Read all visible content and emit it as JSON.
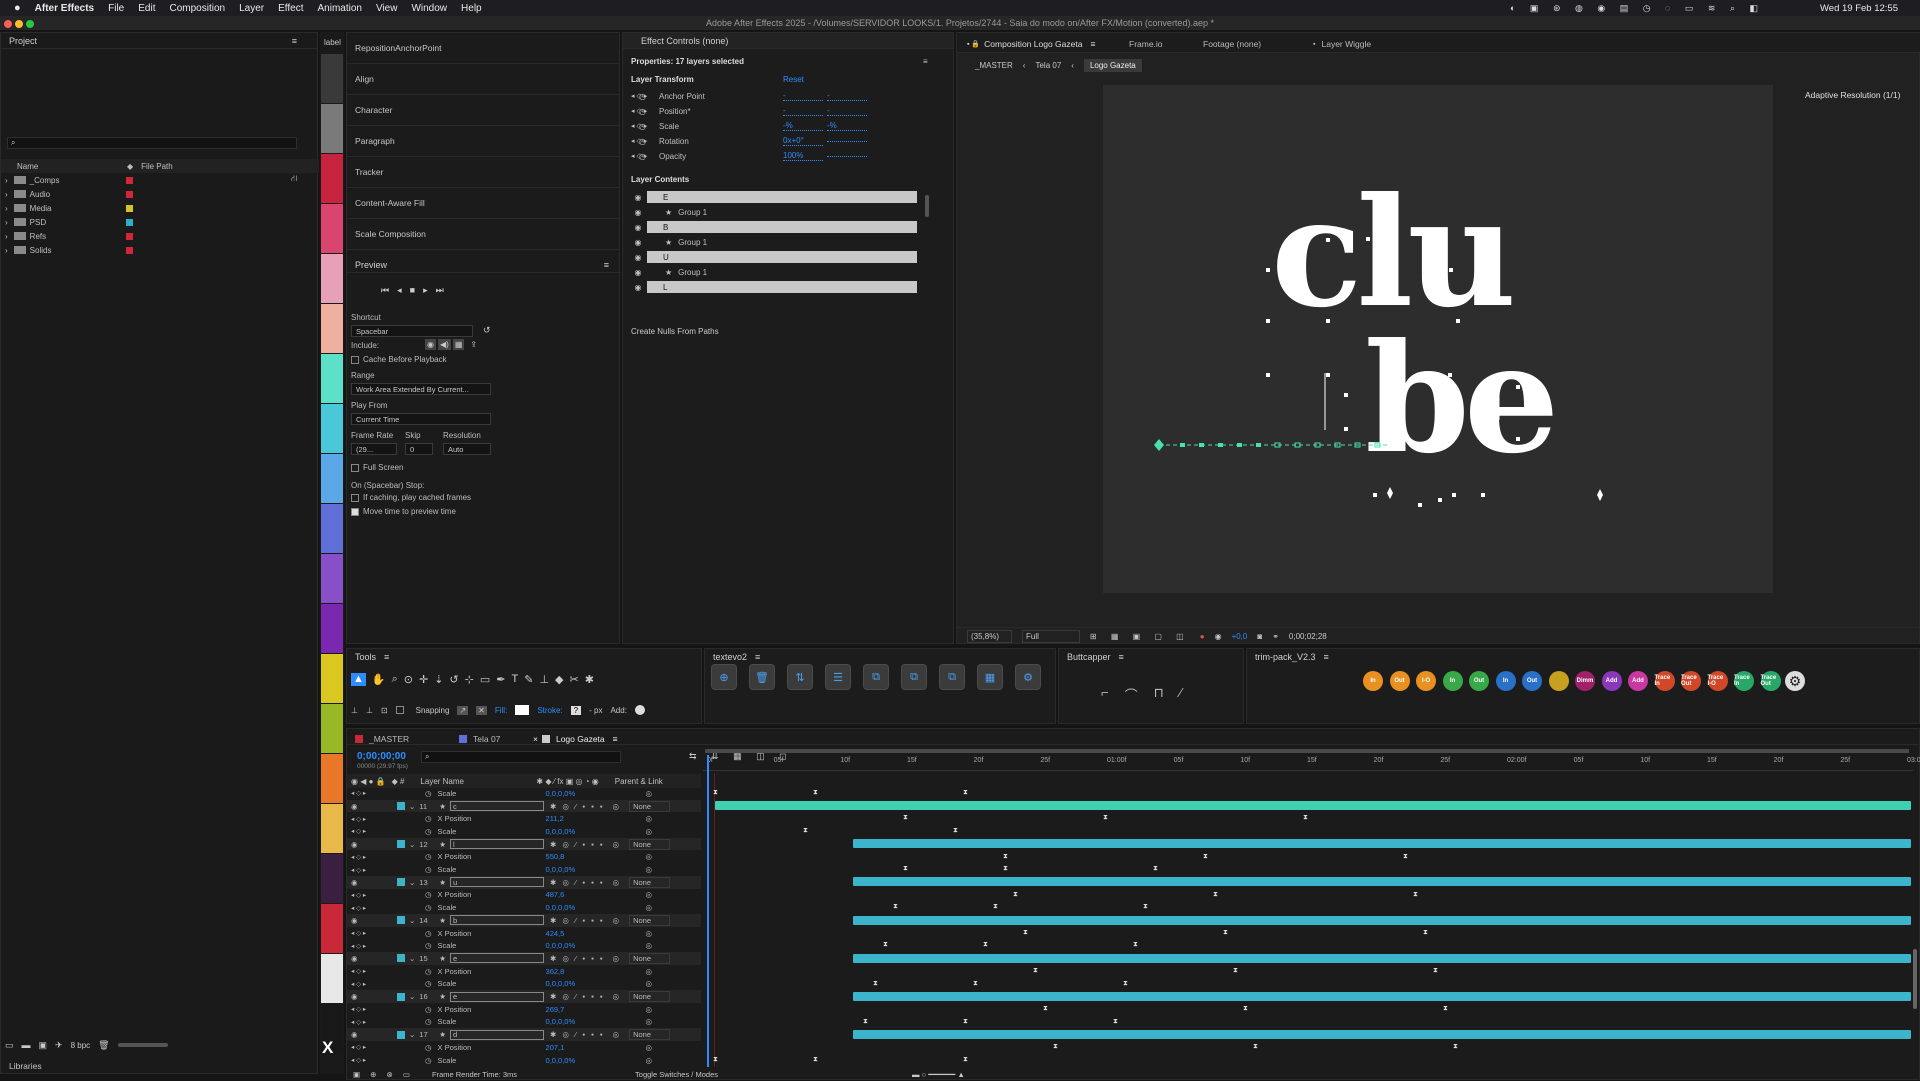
{
  "menubar": {
    "apple": "",
    "app": "After Effects",
    "items": [
      "File",
      "Edit",
      "Composition",
      "Layer",
      "Effect",
      "Animation",
      "View",
      "Window",
      "Help"
    ],
    "clock": "Wed 19 Feb 12:55"
  },
  "window_title": "Adobe After Effects 2025 - /Volumes/SERVIDOR LOOKS/1. Projetos/2744 - Saia do modo on/After FX/Motion (converted).aep *",
  "project": {
    "title": "Project",
    "col_name": "Name",
    "col_path": "File Path",
    "folders": [
      {
        "name": "_Comps",
        "color": "#d0283a"
      },
      {
        "name": "Audio",
        "color": "#d0283a"
      },
      {
        "name": "Media",
        "color": "#d6c22a"
      },
      {
        "name": "PSD",
        "color": "#2ab0c8"
      },
      {
        "name": "Refs",
        "color": "#d0283a"
      },
      {
        "name": "Solids",
        "color": "#d0283a"
      }
    ],
    "bpc": "8 bpc",
    "libraries": "Libraries"
  },
  "label_strip": {
    "title": "label",
    "colors": [
      "#3a3a3a",
      "#7a7a7a",
      "#c8233e",
      "#d9456f",
      "#e8a0b8",
      "#f0b0a0",
      "#5ce0c8",
      "#48c8d8",
      "#5aa8e8",
      "#6070d8",
      "#8850c8",
      "#7a28b0",
      "#d8c820",
      "#98b828",
      "#e87828",
      "#e8b848",
      "#3a2040",
      "#c82838",
      "#e8e8e8",
      "#181818"
    ]
  },
  "scripts": {
    "items": [
      "RepositionAnchorPoint",
      "Align",
      "Character",
      "Paragraph",
      "Tracker",
      "Content-Aware Fill",
      "Scale Composition"
    ]
  },
  "preview": {
    "title": "Preview",
    "shortcut_label": "Shortcut",
    "shortcut": "Spacebar",
    "include_label": "Include:",
    "cache_label": "Cache Before Playback",
    "range_label": "Range",
    "range": "Work Area Extended By Current...",
    "playfrom_label": "Play From",
    "playfrom": "Current Time",
    "framerate_label": "Frame Rate",
    "skip_label": "Skip",
    "resolution_label": "Resolution",
    "framerate": "(29...",
    "skip": "0",
    "resolution": "Auto",
    "fullscreen": "Full Screen",
    "stop_label": "On (Spacebar) Stop:",
    "stop_opt1": "If caching, play cached frames",
    "stop_opt2": "Move time to preview time"
  },
  "effect_controls": {
    "tab": "Effect Controls (none)",
    "props_title": "Properties: 17 layers selected",
    "layer_transform": "Layer Transform",
    "reset": "Reset",
    "props": [
      {
        "name": "Anchor Point",
        "v1": "-",
        "v2": "-"
      },
      {
        "name": "Position*",
        "v1": "-",
        "v2": "-"
      },
      {
        "name": "Scale",
        "v1": "-%",
        "v2": "-%"
      },
      {
        "name": "Rotation",
        "v1": "0x+0°",
        "v2": ""
      },
      {
        "name": "Opacity",
        "v1": "100%",
        "v2": ""
      }
    ],
    "contents_title": "Layer Contents",
    "contents": [
      {
        "name": "E",
        "type": "layer"
      },
      {
        "name": "Group 1",
        "type": "group"
      },
      {
        "name": "B",
        "type": "layer"
      },
      {
        "name": "Group 1",
        "type": "group"
      },
      {
        "name": "U",
        "type": "layer"
      },
      {
        "name": "Group 1",
        "type": "group"
      },
      {
        "name": "L",
        "type": "layer"
      }
    ],
    "create_nulls": "Create Nulls From Paths"
  },
  "comp_viewer": {
    "tabs": [
      "Composition Logo Gazeta",
      "Frame.io",
      "Footage (none)",
      "Layer Wiggle"
    ],
    "breadcrumbs": [
      "_MASTER",
      "Tela 07",
      "Logo Gazeta"
    ],
    "adaptive": "Adaptive Resolution (1/1)",
    "word_line1": "clu",
    "word_line2": "be",
    "zoom": "(35,8%)",
    "quality": "Full",
    "exposure": "+0,0",
    "timecode": "0;00;02;28"
  },
  "tools": {
    "title": "Tools",
    "snapping": "Snapping",
    "fill": "Fill:",
    "stroke": "Stroke:",
    "stroke_val": "?",
    "px": "- px",
    "add": "Add:"
  },
  "textevo": {
    "title": "textevo2"
  },
  "buttcapper": {
    "title": "Buttcapper"
  },
  "trimpack": {
    "title": "trim-pack_V2.3",
    "buttons": [
      {
        "l": "In",
        "c": "#e89020"
      },
      {
        "l": "Out",
        "c": "#e89020"
      },
      {
        "l": "I-O",
        "c": "#e89020"
      },
      {
        "l": "In",
        "c": "#38a848"
      },
      {
        "l": "Out",
        "c": "#38a848"
      },
      {
        "l": "In",
        "c": "#2870c8"
      },
      {
        "l": "Out",
        "c": "#2870c8"
      },
      {
        "l": "",
        "c": "#c8a020"
      },
      {
        "l": "Dimm",
        "c": "#a0206a"
      },
      {
        "l": "Add",
        "c": "#8838b8"
      },
      {
        "l": "Add",
        "c": "#c838a0"
      },
      {
        "l": "Trace In",
        "c": "#d04828"
      },
      {
        "l": "Trace Out",
        "c": "#d04828"
      },
      {
        "l": "Trace I-O",
        "c": "#d04828"
      },
      {
        "l": "Trace In",
        "c": "#28a868"
      },
      {
        "l": "Trace Out",
        "c": "#28a868"
      }
    ]
  },
  "timeline": {
    "tabs": [
      "_MASTER",
      "Tela 07",
      "Logo Gazeta"
    ],
    "timecode": "0;00;00;00",
    "fps": "00000 (29.97 fps)",
    "col_layer": "Layer Name",
    "col_parent": "Parent & Link",
    "ruler": [
      "0f",
      "05f",
      "10f",
      "15f",
      "20f",
      "25f",
      "01:00f",
      "05f",
      "10f",
      "15f",
      "20f",
      "25f",
      "02:00f",
      "05f",
      "10f",
      "15f",
      "20f",
      "25f",
      "03:00f"
    ],
    "rows": [
      {
        "kind": "prop",
        "name": "Scale",
        "value": "0,0,0,0%"
      },
      {
        "kind": "layer",
        "num": "11",
        "name": "c",
        "parent": "None"
      },
      {
        "kind": "prop",
        "name": "X Position",
        "value": "211,2"
      },
      {
        "kind": "prop",
        "name": "Scale",
        "value": "0,0,0,0%"
      },
      {
        "kind": "layer",
        "num": "12",
        "name": "l",
        "parent": "None"
      },
      {
        "kind": "prop",
        "name": "X Position",
        "value": "550,8"
      },
      {
        "kind": "prop",
        "name": "Scale",
        "value": "0,0,0,0%"
      },
      {
        "kind": "layer",
        "num": "13",
        "name": "u",
        "parent": "None"
      },
      {
        "kind": "prop",
        "name": "X Position",
        "value": "487,6"
      },
      {
        "kind": "prop",
        "name": "Scale",
        "value": "0,0,0,0%"
      },
      {
        "kind": "layer",
        "num": "14",
        "name": "b",
        "parent": "None"
      },
      {
        "kind": "prop",
        "name": "X Position",
        "value": "424,5"
      },
      {
        "kind": "prop",
        "name": "Scale",
        "value": "0,0,0,0%"
      },
      {
        "kind": "layer",
        "num": "15",
        "name": "e",
        "parent": "None"
      },
      {
        "kind": "prop",
        "name": "X Position",
        "value": "362,8"
      },
      {
        "kind": "prop",
        "name": "Scale",
        "value": "0,0,0,0%"
      },
      {
        "kind": "layer",
        "num": "16",
        "name": "e",
        "parent": "None"
      },
      {
        "kind": "prop",
        "name": "X Position",
        "value": "269,7"
      },
      {
        "kind": "prop",
        "name": "Scale",
        "value": "0,0,0,0%"
      },
      {
        "kind": "layer",
        "num": "17",
        "name": "d",
        "parent": "None"
      },
      {
        "kind": "prop",
        "name": "X Position",
        "value": "207,1"
      },
      {
        "kind": "prop",
        "name": "Scale",
        "value": "0,0,0,0%"
      }
    ],
    "render_time": "Frame Render Time: 3ms",
    "toggle": "Toggle Switches / Modes"
  },
  "colors": {
    "accent": "#2d8cff",
    "bar_green": "#3ed0b0",
    "bar_cyan": "#3cb4cc"
  }
}
